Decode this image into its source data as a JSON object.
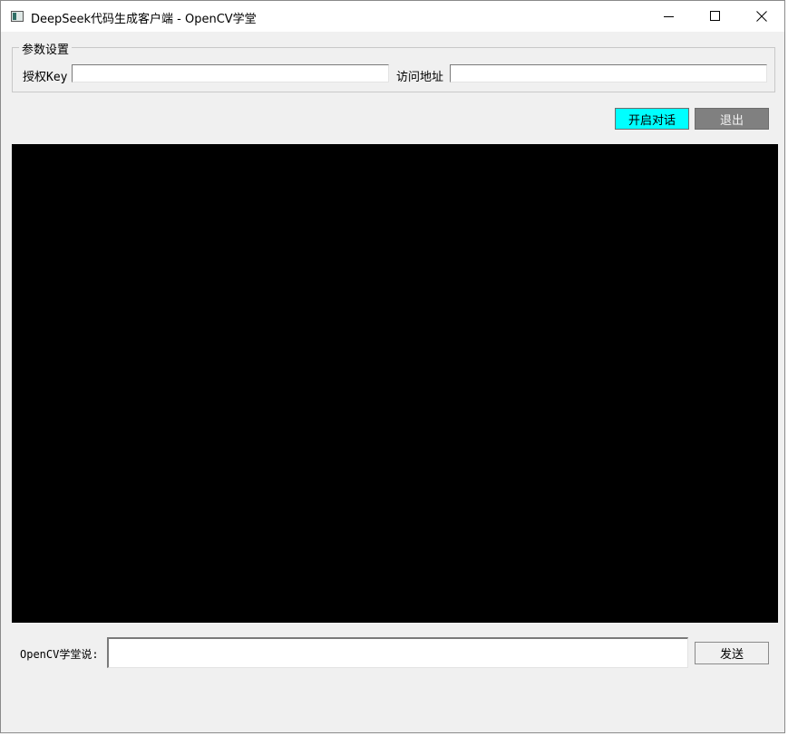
{
  "window": {
    "title": "DeepSeek代码生成客户端 - OpenCV学堂",
    "icons": {
      "app": "app-window-icon",
      "minimize": "minimize-icon",
      "maximize": "maximize-icon",
      "close": "close-icon"
    }
  },
  "settings": {
    "group_title": "参数设置",
    "auth_key_label": "授权Key",
    "auth_key_value": "",
    "url_label": "访问地址",
    "url_value": ""
  },
  "actions": {
    "start_label": "开启对话",
    "exit_label": "退出"
  },
  "chat": {
    "prompt_label": "OpenCV学堂说:",
    "input_value": "",
    "send_label": "发送"
  },
  "colors": {
    "start_button": "#00ffff",
    "exit_button": "#808080",
    "console_background": "#000000",
    "window_background": "#f0f0f0"
  }
}
